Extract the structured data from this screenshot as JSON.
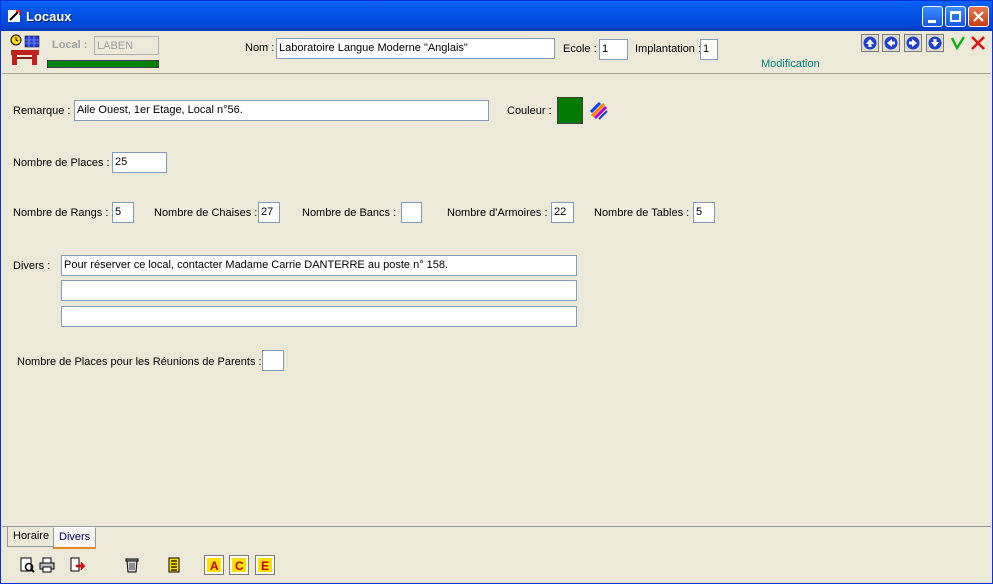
{
  "window": {
    "title": "Locaux"
  },
  "header": {
    "local_label": "Local :",
    "local_value": "LABEN",
    "nom_label": "Nom :",
    "nom_value": "Laboratoire Langue Moderne \"Anglais\"",
    "ecole_label": "Ecole :",
    "ecole_value": "1",
    "implantation_label": "Implantation :",
    "implantation_value": "1",
    "mode": "Modification"
  },
  "form": {
    "remarque_label": "Remarque :",
    "remarque_value": "Aile Ouest, 1er Etage, Local n°56.",
    "couleur_label": "Couleur :",
    "couleur_value": "#007a00",
    "places_label": "Nombre de Places :",
    "places_value": "25",
    "rangs_label": "Nombre de Rangs :",
    "rangs_value": "5",
    "chaises_label": "Nombre de Chaises :",
    "chaises_value": "27",
    "bancs_label": "Nombre de Bancs :",
    "bancs_value": "",
    "armoires_label": "Nombre d'Armoires :",
    "armoires_value": "22",
    "tables_label": "Nombre de Tables :",
    "tables_value": "5",
    "divers_label": "Divers :",
    "divers_lines": [
      "Pour réserver ce local, contacter Madame Carrie DANTERRE au poste n° 158.",
      "",
      ""
    ],
    "reunions_label": "Nombre de Places pour les Réunions de Parents :",
    "reunions_value": ""
  },
  "tabs": [
    {
      "label": "Horaire"
    },
    {
      "label": "Divers"
    }
  ],
  "colors": {
    "accent_status": "#008080",
    "progress": "#008000"
  }
}
